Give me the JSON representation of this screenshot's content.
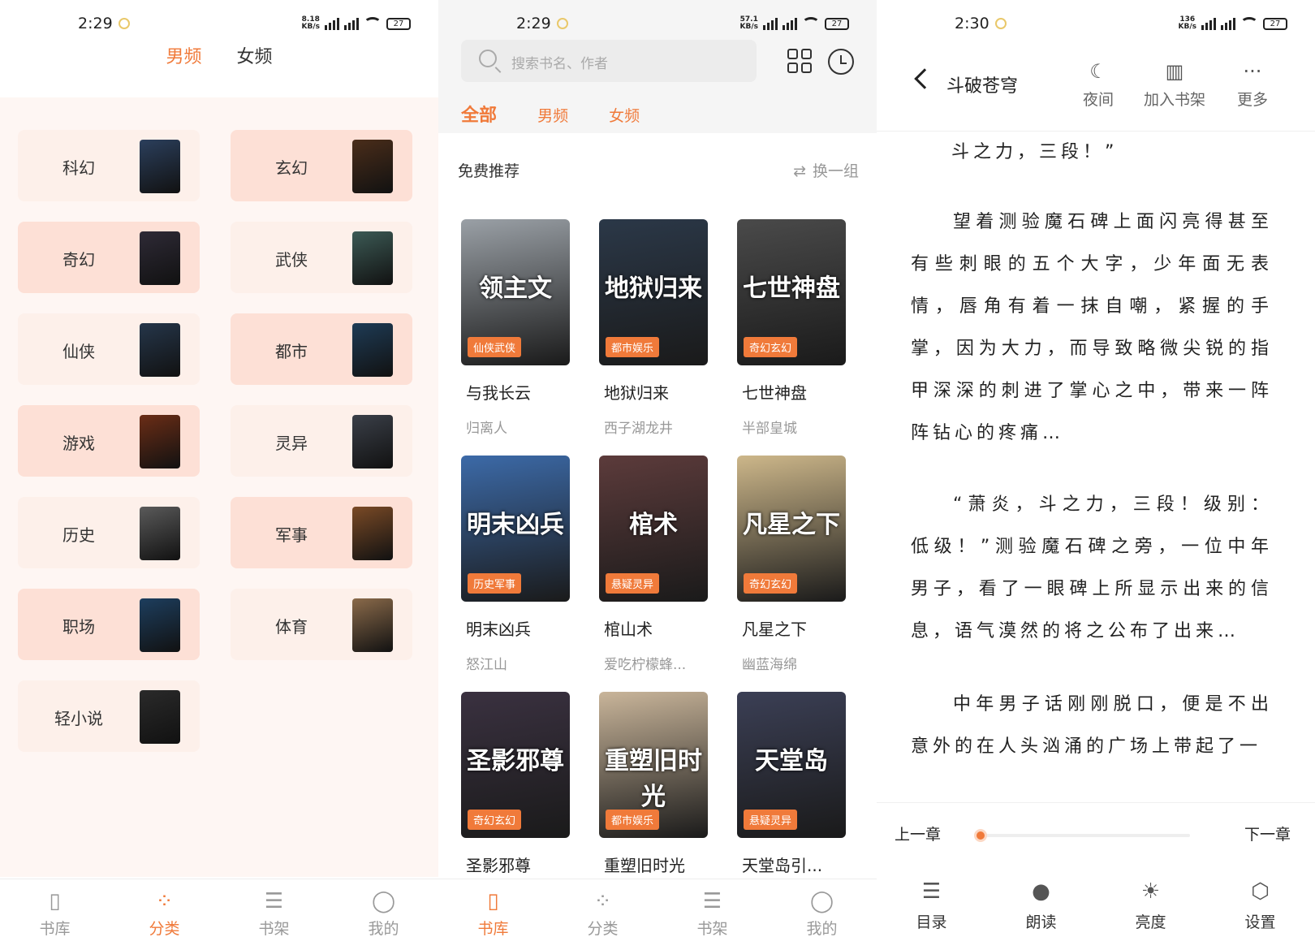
{
  "screen1": {
    "status": {
      "time": "2:29",
      "net_top": "8.18",
      "net_bottom": "KB/s",
      "battery": "27"
    },
    "tabs": [
      {
        "label": "男频",
        "active": true
      },
      {
        "label": "女频",
        "active": false
      }
    ],
    "categories": [
      {
        "label": "科幻",
        "cover_color": "#2b3f5c",
        "highlight": false
      },
      {
        "label": "玄幻",
        "cover_color": "#4a2d1a",
        "highlight": true
      },
      {
        "label": "奇幻",
        "cover_color": "#2e2a36",
        "highlight": true
      },
      {
        "label": "武侠",
        "cover_color": "#3c5a55",
        "highlight": false
      },
      {
        "label": "仙侠",
        "cover_color": "#25364a",
        "highlight": false
      },
      {
        "label": "都市",
        "cover_color": "#1e3b55",
        "highlight": true
      },
      {
        "label": "游戏",
        "cover_color": "#6b2d16",
        "highlight": true
      },
      {
        "label": "灵异",
        "cover_color": "#3a3f48",
        "highlight": false
      },
      {
        "label": "历史",
        "cover_color": "#5a5a5a",
        "highlight": false
      },
      {
        "label": "军事",
        "cover_color": "#7a4a26",
        "highlight": true
      },
      {
        "label": "职场",
        "cover_color": "#1d3e5e",
        "highlight": true
      },
      {
        "label": "体育",
        "cover_color": "#8a6a4a",
        "highlight": false
      },
      {
        "label": "轻小说",
        "cover_color": "#2a2a2a",
        "highlight": false
      }
    ],
    "tabbar": [
      {
        "label": "书库",
        "icon": "book-icon",
        "active": false
      },
      {
        "label": "分类",
        "icon": "category-icon",
        "active": true
      },
      {
        "label": "书架",
        "icon": "shelf-icon",
        "active": false
      },
      {
        "label": "我的",
        "icon": "user-icon",
        "active": false
      }
    ]
  },
  "screen2": {
    "status": {
      "time": "2:29",
      "net_top": "57.1",
      "net_bottom": "KB/s",
      "battery": "27"
    },
    "search_placeholder": "搜索书名、作者",
    "tabs": [
      {
        "label": "全部",
        "active": true
      },
      {
        "label": "男频",
        "active": false
      },
      {
        "label": "女频",
        "active": false
      }
    ],
    "section_title": "免费推荐",
    "refresh_label": "换一组",
    "books": [
      {
        "title": "与我长云",
        "author": "归离人",
        "tag": "仙侠武侠",
        "cover_text": "领主文",
        "cover_color": "#9aa0a6"
      },
      {
        "title": "地狱归来",
        "author": "西子湖龙井",
        "tag": "都市娱乐",
        "cover_text": "地狱归来",
        "cover_color": "#2b3848"
      },
      {
        "title": "七世神盘",
        "author": "半部皇城",
        "tag": "奇幻玄幻",
        "cover_text": "七世神盘",
        "cover_color": "#4a4a4a"
      },
      {
        "title": "明末凶兵",
        "author": "怒江山",
        "tag": "历史军事",
        "cover_text": "明末凶兵",
        "cover_color": "#3c6aa8"
      },
      {
        "title": "棺山术",
        "author": "爱吃柠檬蜂...",
        "tag": "悬疑灵异",
        "cover_text": "棺术",
        "cover_color": "#5c3b3b"
      },
      {
        "title": "凡星之下",
        "author": "幽蓝海绵",
        "tag": "奇幻玄幻",
        "cover_text": "凡星之下",
        "cover_color": "#cdb78a"
      },
      {
        "title": "圣影邪尊",
        "author": "",
        "tag": "奇幻玄幻",
        "cover_text": "圣影邪尊",
        "cover_color": "#3a3140"
      },
      {
        "title": "重塑旧时光",
        "author": "",
        "tag": "都市娱乐",
        "cover_text": "重塑旧时光",
        "cover_color": "#c9b59a"
      },
      {
        "title": "天堂岛引...",
        "author": "",
        "tag": "悬疑灵异",
        "cover_text": "天堂岛",
        "cover_color": "#3b3f55"
      }
    ],
    "tabbar": [
      {
        "label": "书库",
        "icon": "book-icon",
        "active": true
      },
      {
        "label": "分类",
        "icon": "category-icon",
        "active": false
      },
      {
        "label": "书架",
        "icon": "shelf-icon",
        "active": false
      },
      {
        "label": "我的",
        "icon": "user-icon",
        "active": false
      }
    ]
  },
  "screen3": {
    "status": {
      "time": "2:30",
      "net_top": "136",
      "net_bottom": "KB/s",
      "battery": "27"
    },
    "book_title": "斗破苍穹",
    "header_buttons": [
      {
        "label": "夜间",
        "icon": "moon-icon"
      },
      {
        "label": "加入书架",
        "icon": "add-shelf-icon"
      },
      {
        "label": "更多",
        "icon": "more-icon"
      }
    ],
    "paragraphs": [
      "斗之力，三段！”",
      "望着测验魔石碑上面闪亮得甚至有些刺眼的五个大字，少年面无表情，唇角有着一抹自嘲，紧握的手掌，因为大力，而导致略微尖锐的指甲深深的刺进了掌心之中，带来一阵阵钻心的疼痛…",
      "“萧炎，斗之力，三段！级别：低级！”测验魔石碑之旁，一位中年男子，看了一眼碑上所显示出来的信息，语气漠然的将之公布了出来…",
      "中年男子话刚刚脱口，便是不出意外的在人头汹涌的广场上带起了一"
    ],
    "prev_chapter": "上一章",
    "next_chapter": "下一章",
    "progress": 0.0,
    "tools": [
      {
        "label": "目录",
        "icon": "catalog-icon"
      },
      {
        "label": "朗读",
        "icon": "microphone-icon"
      },
      {
        "label": "亮度",
        "icon": "brightness-icon"
      },
      {
        "label": "设置",
        "icon": "settings-icon"
      }
    ]
  }
}
